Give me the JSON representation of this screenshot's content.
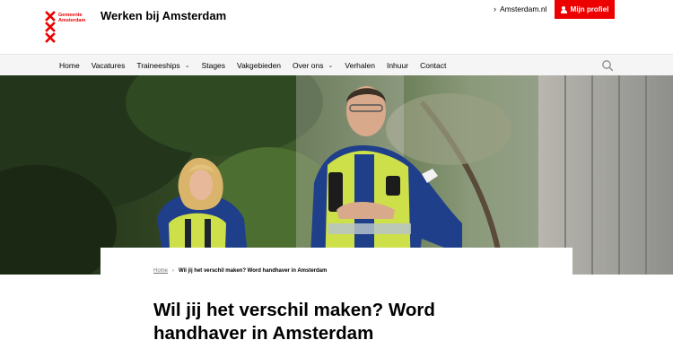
{
  "header": {
    "logo_line1": "Gemeente",
    "logo_line2": "Amsterdam",
    "site_title": "Werken bij Amsterdam",
    "external_link": "Amsterdam.nl",
    "profile_button": "Mijn profiel"
  },
  "nav": {
    "items": [
      {
        "label": "Home",
        "has_caret": false
      },
      {
        "label": "Vacatures",
        "has_caret": false
      },
      {
        "label": "Traineeships",
        "has_caret": true
      },
      {
        "label": "Stages",
        "has_caret": false
      },
      {
        "label": "Vakgebieden",
        "has_caret": false
      },
      {
        "label": "Over ons",
        "has_caret": true
      },
      {
        "label": "Verhalen",
        "has_caret": false
      },
      {
        "label": "Inhuur",
        "has_caret": false
      },
      {
        "label": "Contact",
        "has_caret": false
      }
    ],
    "search_icon": "search-icon"
  },
  "breadcrumb": {
    "home": "Home",
    "current": "Wil jij het verschil maken? Word handhaver in Amsterdam"
  },
  "page": {
    "title": "Wil jij het verschil maken? Word handhaver in Amsterdam"
  },
  "colors": {
    "brand_red": "#ec0000",
    "nav_bg": "#f5f5f5",
    "vest_yellow": "#cde04a",
    "uniform_blue": "#1f3f8a"
  }
}
